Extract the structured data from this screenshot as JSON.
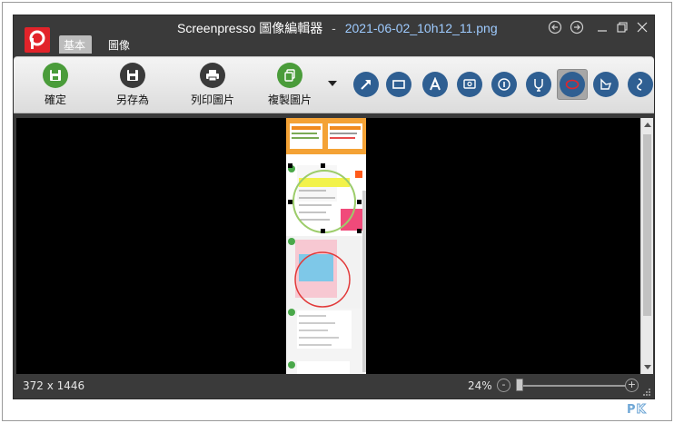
{
  "window": {
    "app_name": "Screenpresso",
    "editor_title": "圖像編輯器",
    "separator": "-",
    "filename": "2021-06-02_10h12_11.png",
    "app_logo_letter": "P",
    "controls": [
      "back-icon",
      "forward-icon",
      "minimize-icon",
      "restore-icon",
      "close-icon"
    ]
  },
  "tabs": [
    {
      "label": "基本",
      "active": true
    },
    {
      "label": "圖像",
      "active": false
    }
  ],
  "ribbon": {
    "buttons": [
      {
        "label": "確定",
        "icon": "save-icon",
        "color": "#4a9c3a"
      },
      {
        "label": "另存為",
        "icon": "save-as-icon",
        "color": "#3a3a3a"
      },
      {
        "label": "列印圖片",
        "icon": "printer-icon",
        "color": "#3a3a3a"
      },
      {
        "label": "複製圖片",
        "icon": "copy-icon",
        "color": "#4a9c3a"
      }
    ],
    "tools": [
      "arrow-icon",
      "rectangle-icon",
      "text-icon",
      "callout-icon",
      "numbered-step-icon",
      "highlighter-icon",
      "ellipse-icon",
      "polygon-icon",
      "freehand-icon"
    ],
    "selected_tool": "ellipse-icon",
    "tool_color": "#2f5f92"
  },
  "statusbar": {
    "dimensions": "372 x 1446",
    "zoom": "24%",
    "zoom_out": "-",
    "zoom_in": "+"
  },
  "watermark": {
    "p": "P",
    "k": "K"
  }
}
